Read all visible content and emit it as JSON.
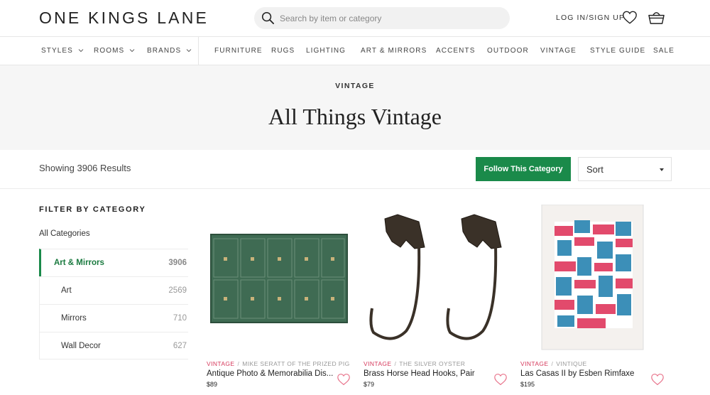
{
  "header": {
    "logo": "ONE KINGS LANE",
    "search_placeholder": "Search by item or category",
    "login_label": "LOG IN/SIGN UP"
  },
  "nav": {
    "dropdowns": [
      "STYLES",
      "ROOMS",
      "BRANDS"
    ],
    "links": [
      "FURNITURE",
      "RUGS",
      "LIGHTING",
      "ART & MIRRORS",
      "ACCENTS",
      "OUTDOOR",
      "VINTAGE",
      "STYLE GUIDE",
      "SALE"
    ]
  },
  "hero": {
    "eyebrow": "VINTAGE",
    "title": "All Things Vintage"
  },
  "toolbar": {
    "results_text": "Showing 3906 Results",
    "follow_label": "Follow This Category",
    "sort_label": "Sort"
  },
  "sidebar": {
    "title": "FILTER BY CATEGORY",
    "all_label": "All Categories",
    "categories": [
      {
        "name": "Art & Mirrors",
        "count": "3906"
      },
      {
        "name": "Art",
        "count": "2569"
      },
      {
        "name": "Mirrors",
        "count": "710"
      },
      {
        "name": "Wall Decor",
        "count": "627"
      }
    ]
  },
  "products": [
    {
      "tag": "VINTAGE",
      "vendor": "MIKE SERATT OF THE PRIZED PIG",
      "name": "Antique Photo & Memorabilia Dis...",
      "price": "$89"
    },
    {
      "tag": "VINTAGE",
      "vendor": "THE SILVER OYSTER",
      "name": "Brass Horse Head Hooks, Pair",
      "price": "$79"
    },
    {
      "tag": "VINTAGE",
      "vendor": "VINTIQUE",
      "name": "Las Casas II by Esben Rimfaxe",
      "price": "$195"
    }
  ],
  "colors": {
    "accent_green": "#1a8a4a",
    "vintage_tag": "#d6395c",
    "hero_bg": "#f6f6f6"
  }
}
